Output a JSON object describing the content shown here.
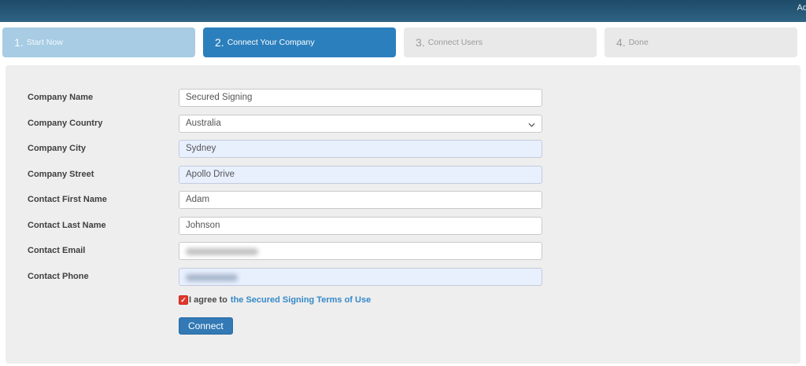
{
  "header": {
    "right_text": "Ad"
  },
  "steps": [
    {
      "number": "1.",
      "label": "Start Now",
      "state": "visited"
    },
    {
      "number": "2.",
      "label": "Connect Your Company",
      "state": "active"
    },
    {
      "number": "3.",
      "label": "Connect Users",
      "state": "pending"
    },
    {
      "number": "4.",
      "label": "Done",
      "state": "pending"
    }
  ],
  "form": {
    "fields": [
      {
        "label": "Company Name",
        "value": "Secured Signing",
        "type": "text",
        "autofill": false,
        "redacted": false
      },
      {
        "label": "Company Country",
        "value": "Australia",
        "type": "select",
        "autofill": false,
        "redacted": false
      },
      {
        "label": "Company City",
        "value": "Sydney",
        "type": "text",
        "autofill": true,
        "redacted": false
      },
      {
        "label": "Company Street",
        "value": "Apollo Drive",
        "type": "text",
        "autofill": true,
        "redacted": false
      },
      {
        "label": "Contact First Name",
        "value": "Adam",
        "type": "text",
        "autofill": false,
        "redacted": false
      },
      {
        "label": "Contact Last Name",
        "value": "Johnson",
        "type": "text",
        "autofill": false,
        "redacted": false
      },
      {
        "label": "Contact Email",
        "value": "",
        "type": "text",
        "autofill": false,
        "redacted": true
      },
      {
        "label": "Contact Phone",
        "value": "",
        "type": "text",
        "autofill": true,
        "redacted": true
      }
    ],
    "agree": {
      "checked": true,
      "text": "I agree to",
      "link": "the Secured Signing Terms of Use"
    },
    "submit_label": "Connect"
  },
  "icons": {
    "checkmark": "✓",
    "chevron_down": "chevron-down"
  },
  "colors": {
    "header_top": "#1d4b68",
    "header_bottom": "#306384",
    "step_visited_bg": "#a7cce4",
    "step_active_bg": "#2b7fbd",
    "step_pending_bg": "#e9e9e9",
    "card_bg": "#eeeeee",
    "autofill_bg": "#e8f0fe",
    "checkbox_red": "#e2382c",
    "link_blue": "#3489c8",
    "button_blue": "#3279b5"
  }
}
